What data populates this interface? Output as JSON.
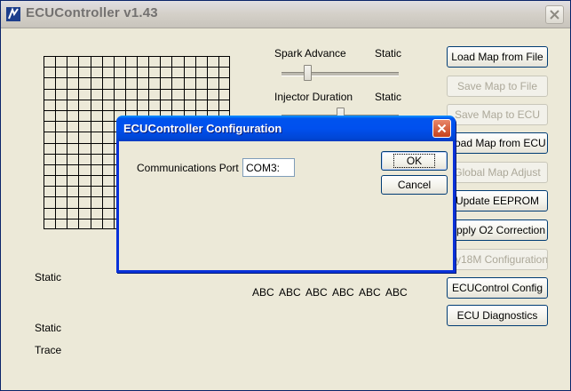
{
  "window": {
    "title": "ECUController v1.43"
  },
  "sliders": [
    {
      "label": "Spark Advance",
      "mode": "Static",
      "value": 0.2
    },
    {
      "label": "Injector Duration",
      "mode": "Static",
      "value": 0.5
    }
  ],
  "buttons": [
    {
      "label": "Load Map from File",
      "enabled": true
    },
    {
      "label": "Save Map to File",
      "enabled": false
    },
    {
      "label": "Save Map to ECU",
      "enabled": false
    },
    {
      "label": "Load Map from ECU",
      "enabled": true
    },
    {
      "label": "Global Map Adjust",
      "enabled": false
    },
    {
      "label": "Update EEPROM",
      "enabled": true
    },
    {
      "label": "Apply O2 Correction",
      "enabled": true
    },
    {
      "label": "My18M Configuration",
      "enabled": false
    },
    {
      "label": "ECUControl Config",
      "enabled": true
    },
    {
      "label": "ECU Diagnostics",
      "enabled": true
    }
  ],
  "left_labels": {
    "static1": "Static",
    "static2": "Static",
    "trace": "Trace"
  },
  "abc_labels": [
    "ABC",
    "ABC",
    "ABC",
    "ABC",
    "ABC",
    "ABC"
  ],
  "dialog": {
    "title": "ECUController Configuration",
    "port_label": "Communications Port",
    "port_value": "COM3:",
    "ok_label": "OK",
    "cancel_label": "Cancel"
  },
  "colors": {
    "dialog_title": "#0053ee",
    "close_red": "#c6411c",
    "window_bg": "#ece9d8"
  }
}
